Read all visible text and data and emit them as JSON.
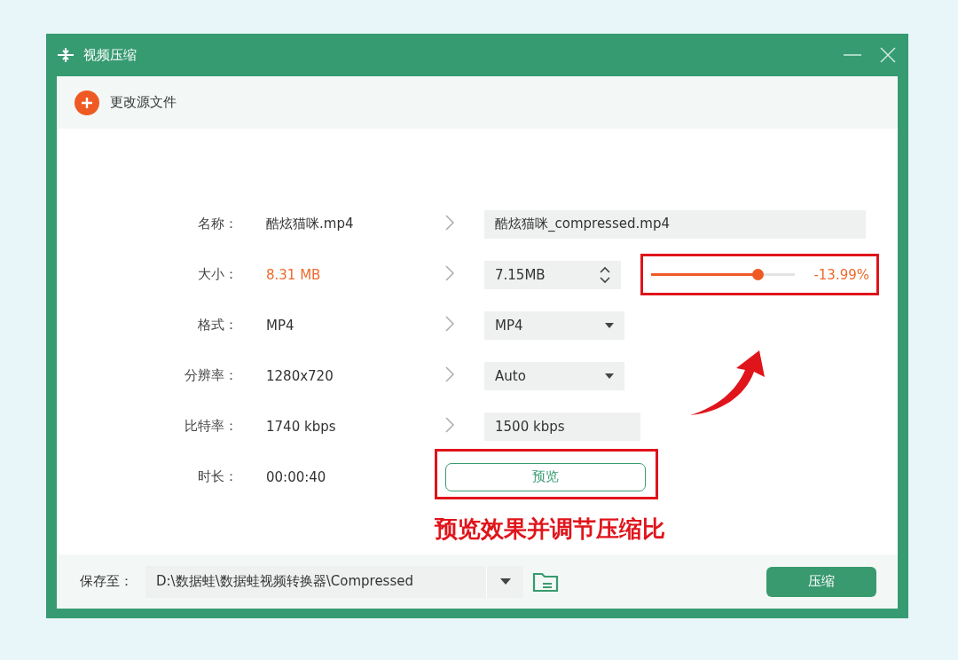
{
  "window": {
    "title": "视频压缩"
  },
  "toolbar": {
    "change_source": "更改源文件"
  },
  "rows": [
    {
      "label": "名称：",
      "source": "酷炫猫咪.mp4",
      "highlighted": false,
      "kind": "text",
      "target": "酷炫猫咪_compressed.mp4"
    },
    {
      "label": "大小：",
      "source": "8.31 MB",
      "highlighted": true,
      "kind": "spinner",
      "target": "7.15MB",
      "slider": {
        "level": 0.74,
        "reading": "-13.99%"
      }
    },
    {
      "label": "格式：",
      "source": "MP4",
      "highlighted": false,
      "kind": "select",
      "target": "MP4"
    },
    {
      "label": "分辨率：",
      "source": "1280x720",
      "highlighted": false,
      "kind": "select",
      "target": "Auto"
    },
    {
      "label": "比特率：",
      "source": "1740 kbps",
      "highlighted": false,
      "kind": "short",
      "target": "1500 kbps"
    },
    {
      "label": "时长：",
      "source": "00:00:40",
      "highlighted": false,
      "kind": "preview",
      "target": "预览"
    }
  ],
  "annotation": "预览效果并调节压缩比",
  "footer": {
    "save_label": "保存至：",
    "path": "D:\\数据蛙\\数据蛙视频转换器\\Compressed",
    "compress_button": "压缩"
  }
}
